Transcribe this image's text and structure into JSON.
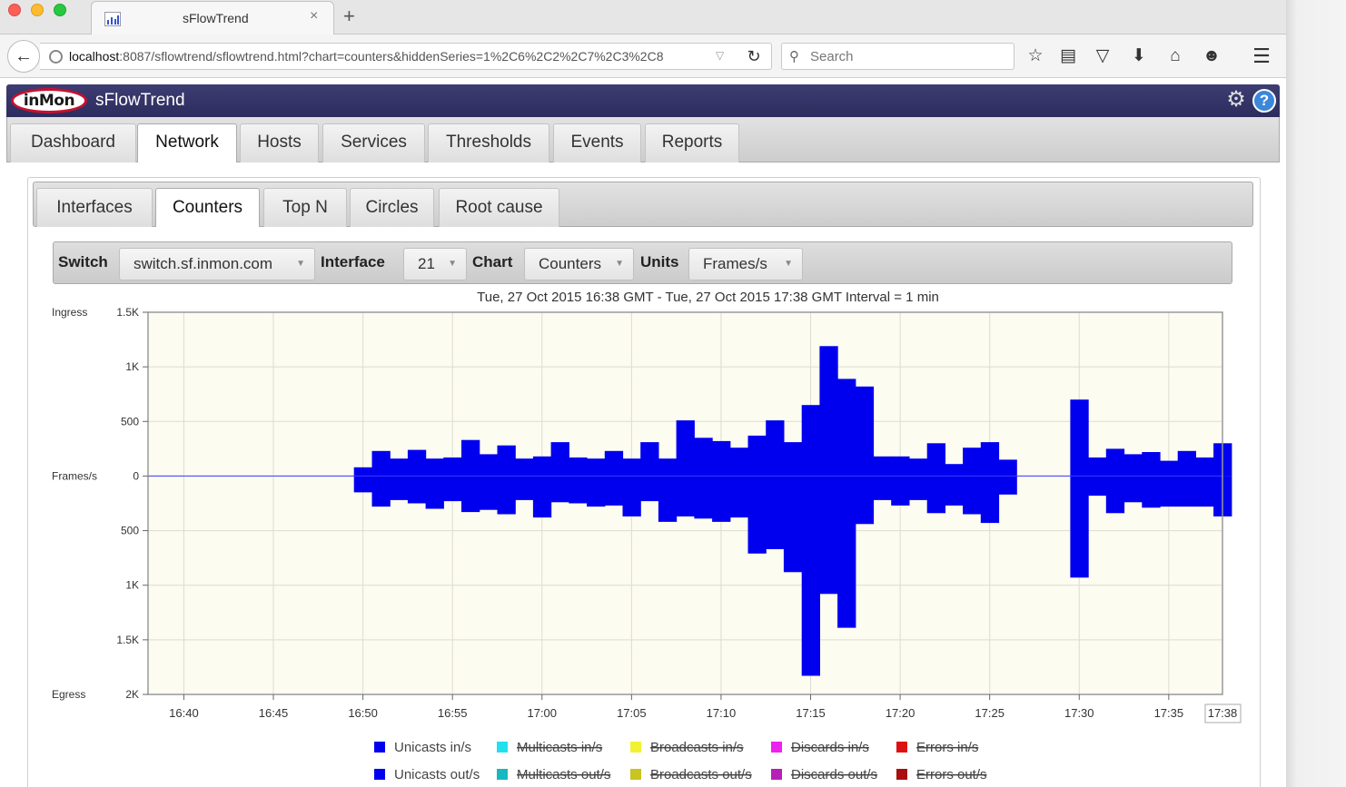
{
  "browser": {
    "tab_title": "sFlowTrend",
    "tab_close": "×",
    "new_tab": "+",
    "url_host": "localhost",
    "url_rest": ":8087/sflowtrend/sflowtrend.html?chart=counters&hiddenSeries=1%2C6%2C2%2C7%2C3%2C8",
    "search_placeholder": "Search"
  },
  "app": {
    "logo_text": "inMon",
    "title": "sFlowTrend"
  },
  "main_tabs": [
    {
      "label": "Dashboard"
    },
    {
      "label": "Network"
    },
    {
      "label": "Hosts"
    },
    {
      "label": "Services"
    },
    {
      "label": "Thresholds"
    },
    {
      "label": "Events"
    },
    {
      "label": "Reports"
    }
  ],
  "main_tab_active": "Network",
  "sub_tabs": [
    {
      "label": "Interfaces"
    },
    {
      "label": "Counters"
    },
    {
      "label": "Top N"
    },
    {
      "label": "Circles"
    },
    {
      "label": "Root cause"
    }
  ],
  "sub_tab_active": "Counters",
  "controls": {
    "switch_label": "Switch",
    "switch_value": "switch.sf.inmon.com",
    "interface_label": "Interface",
    "interface_value": "21",
    "chart_label": "Chart",
    "chart_value": "Counters",
    "units_label": "Units",
    "units_value": "Frames/s"
  },
  "chart_data": {
    "type": "area",
    "title": "Tue, 27 Oct 2015 16:38 GMT - Tue, 27 Oct 2015 17:38 GMT Interval = 1 min",
    "ylabel": "Frames/s",
    "ylabel_top": "Ingress",
    "ylabel_bottom": "Egress",
    "y_ticks": [
      "1.5K",
      "1K",
      "500",
      "0",
      "500",
      "1K",
      "1.5K",
      "2K"
    ],
    "y_tick_values": [
      1500,
      1000,
      500,
      0,
      -500,
      -1000,
      -1500,
      -2000
    ],
    "ylim": [
      -2000,
      1500
    ],
    "xlim": [
      "16:38",
      "17:38"
    ],
    "x_ticks": [
      "16:40",
      "16:45",
      "16:50",
      "16:55",
      "17:00",
      "17:05",
      "17:10",
      "17:15",
      "17:20",
      "17:25",
      "17:30",
      "17:35"
    ],
    "x_current": "17:38",
    "grid": true,
    "background": "#fdfcf1",
    "legend_position": "bottom",
    "x": [
      "16:50",
      "16:51",
      "16:52",
      "16:53",
      "16:54",
      "16:55",
      "16:56",
      "16:57",
      "16:58",
      "16:59",
      "17:00",
      "17:01",
      "17:02",
      "17:03",
      "17:04",
      "17:05",
      "17:06",
      "17:07",
      "17:08",
      "17:09",
      "17:10",
      "17:11",
      "17:12",
      "17:13",
      "17:14",
      "17:15",
      "17:16",
      "17:17",
      "17:18",
      "17:19",
      "17:20",
      "17:21",
      "17:22",
      "17:23",
      "17:24",
      "17:25",
      "17:26",
      "17:27",
      "17:28",
      "17:29",
      "17:30",
      "17:31",
      "17:32",
      "17:33",
      "17:34",
      "17:35",
      "17:36",
      "17:37",
      "17:38"
    ],
    "series": [
      {
        "name": "Unicasts in/s",
        "color": "#0000ee",
        "hidden": false,
        "values": [
          80,
          230,
          160,
          240,
          160,
          170,
          330,
          200,
          280,
          160,
          180,
          310,
          170,
          160,
          230,
          160,
          310,
          160,
          510,
          350,
          320,
          260,
          370,
          510,
          310,
          650,
          1190,
          890,
          820,
          180,
          180,
          160,
          300,
          110,
          260,
          310,
          150,
          null,
          null,
          null,
          700,
          170,
          250,
          200,
          220,
          140,
          230,
          170,
          300
        ]
      },
      {
        "name": "Unicasts out/s",
        "color": "#0000ee",
        "hidden": false,
        "values": [
          -150,
          -280,
          -220,
          -250,
          -300,
          -230,
          -330,
          -310,
          -350,
          -220,
          -380,
          -240,
          -250,
          -280,
          -270,
          -370,
          -230,
          -420,
          -370,
          -390,
          -420,
          -380,
          -710,
          -670,
          -880,
          -1830,
          -1080,
          -1390,
          -440,
          -220,
          -270,
          -220,
          -340,
          -270,
          -350,
          -430,
          -170,
          null,
          null,
          null,
          -930,
          -180,
          -340,
          -240,
          -290,
          -280,
          -280,
          -280,
          -370
        ]
      },
      {
        "name": "Multicasts in/s",
        "color": "#22e0ee",
        "hidden": true,
        "values": []
      },
      {
        "name": "Multicasts out/s",
        "color": "#17b8bf",
        "hidden": true,
        "values": []
      },
      {
        "name": "Broadcasts in/s",
        "color": "#f2f232",
        "hidden": true,
        "values": []
      },
      {
        "name": "Broadcasts out/s",
        "color": "#c8c420",
        "hidden": true,
        "values": []
      },
      {
        "name": "Discards in/s",
        "color": "#ee22ee",
        "hidden": true,
        "values": []
      },
      {
        "name": "Discards out/s",
        "color": "#b81fb8",
        "hidden": true,
        "values": []
      },
      {
        "name": "Errors in/s",
        "color": "#dd1111",
        "hidden": true,
        "values": []
      },
      {
        "name": "Errors out/s",
        "color": "#aa0e0e",
        "hidden": true,
        "values": []
      }
    ]
  }
}
